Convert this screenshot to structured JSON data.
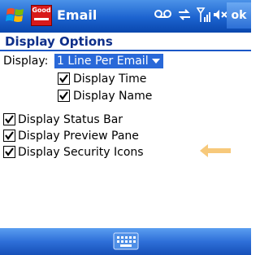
{
  "titlebar": {
    "logo_text": "Good",
    "app_title": "Email",
    "ok_label": "ok"
  },
  "header": {
    "title": "Display Options"
  },
  "display": {
    "label": "Display:",
    "selected": "1 Line Per Email",
    "sub_options": [
      {
        "label": "Display Time",
        "checked": true
      },
      {
        "label": "Display Name",
        "checked": true
      }
    ]
  },
  "options": [
    {
      "label": "Display Status Bar",
      "checked": true
    },
    {
      "label": "Display Preview Pane",
      "checked": true
    },
    {
      "label": "Display Security Icons",
      "checked": true
    }
  ],
  "colors": {
    "accent": "#1c63cf",
    "selection": "#2968d8",
    "arrow": "#f7c97b"
  },
  "icons": [
    "windows-flag-icon",
    "voicemail-icon",
    "sync-icon",
    "signal-icon",
    "speaker-mute-icon",
    "keyboard-icon",
    "highlight-arrow-icon"
  ]
}
